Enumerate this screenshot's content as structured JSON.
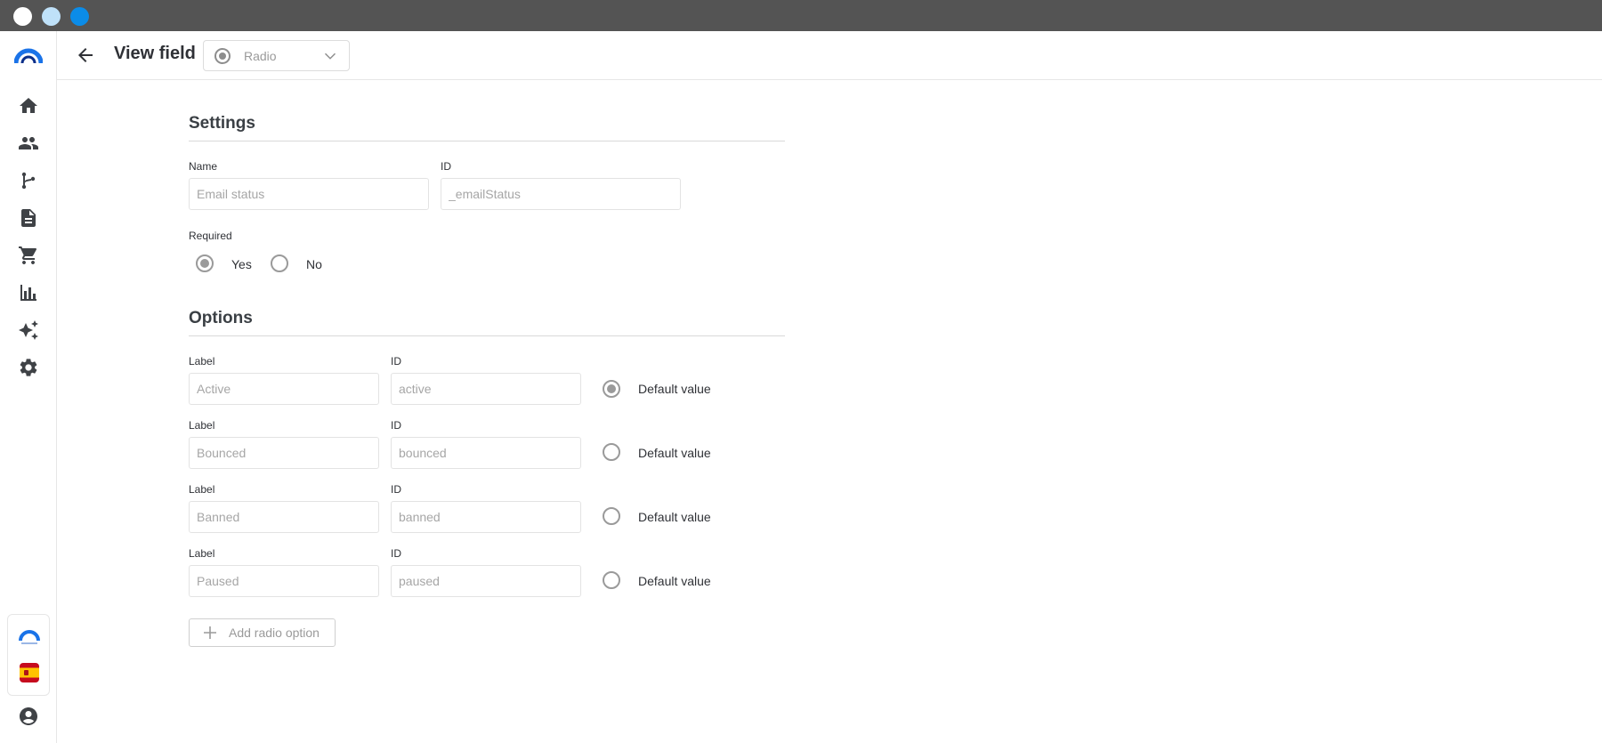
{
  "window": {
    "controls": [
      "close",
      "minimize",
      "maximize"
    ]
  },
  "sidebar": {
    "items": [
      {
        "name": "home",
        "icon": "home-icon"
      },
      {
        "name": "contacts",
        "icon": "people-icon"
      },
      {
        "name": "flows",
        "icon": "branch-icon"
      },
      {
        "name": "documents",
        "icon": "document-icon"
      },
      {
        "name": "commerce",
        "icon": "cart-icon"
      },
      {
        "name": "analytics",
        "icon": "bar-chart-icon"
      },
      {
        "name": "ai",
        "icon": "sparkles-icon"
      },
      {
        "name": "settings",
        "icon": "gear-icon"
      }
    ],
    "footer": {
      "language": "es",
      "user_icon": "account-circle-icon"
    }
  },
  "header": {
    "title": "View field",
    "field_type": "Radio"
  },
  "settings": {
    "title": "Settings",
    "name_label": "Name",
    "name_value": "Email status",
    "id_label": "ID",
    "id_value": "_emailStatus",
    "required_label": "Required",
    "required_options": [
      {
        "label": "Yes",
        "checked": true
      },
      {
        "label": "No",
        "checked": false
      }
    ]
  },
  "options": {
    "title": "Options",
    "items": [
      {
        "label_caption": "Label",
        "label": "Active",
        "id_caption": "ID",
        "id": "active",
        "default_caption": "Default value",
        "default": true
      },
      {
        "label_caption": "Label",
        "label": "Bounced",
        "id_caption": "ID",
        "id": "bounced",
        "default_caption": "Default value",
        "default": false
      },
      {
        "label_caption": "Label",
        "label": "Banned",
        "id_caption": "ID",
        "id": "banned",
        "default_caption": "Default value",
        "default": false
      },
      {
        "label_caption": "Label",
        "label": "Paused",
        "id_caption": "ID",
        "id": "paused",
        "default_caption": "Default value",
        "default": false
      }
    ],
    "add_button": "Add radio option"
  },
  "colors": {
    "brand_blue": "#1a73e8",
    "titlebar": "#545454"
  }
}
